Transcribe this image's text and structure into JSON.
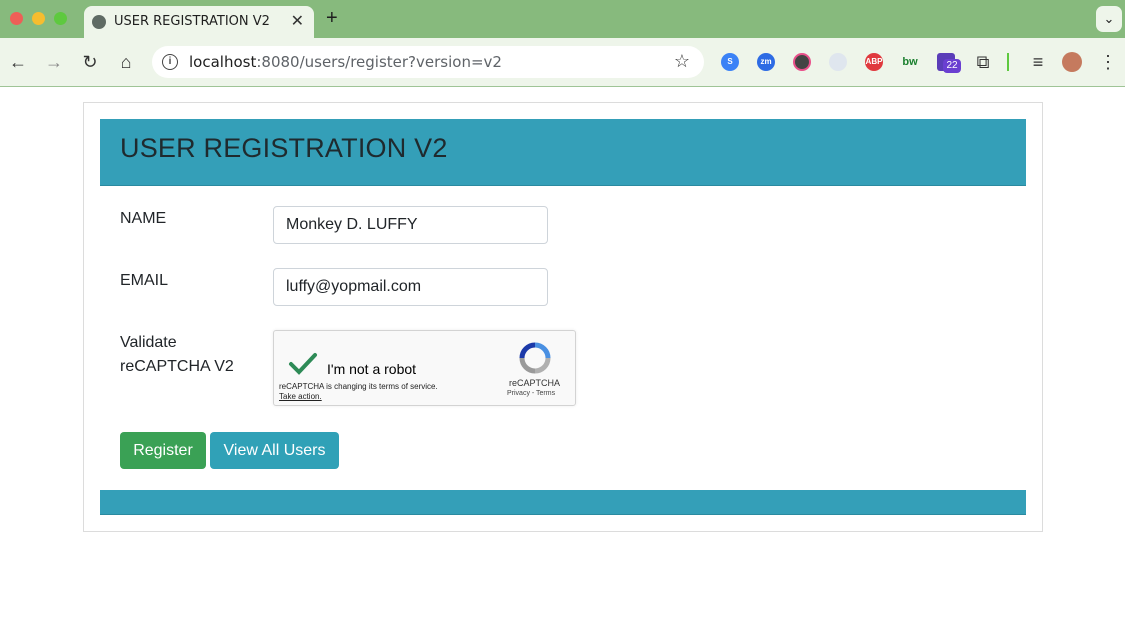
{
  "browser": {
    "tab_title": "USER REGISTRATION V2",
    "tab_close": "✕",
    "new_tab": "+",
    "menu_chevron": "⌄",
    "url_host": "localhost",
    "url_rest": ":8080/users/register?version=v2",
    "extensions": [
      {
        "name": "zm",
        "color": "#2d6be4"
      },
      {
        "name": "ABP",
        "color": "#e0393e"
      },
      {
        "name": "bw",
        "color": "#1a7f2e"
      }
    ],
    "badge_count": "22"
  },
  "page": {
    "title": "USER REGISTRATION V2",
    "name_label": "NAME",
    "name_value": "Monkey D. LUFFY",
    "email_label": "EMAIL",
    "email_value": "luffy@yopmail.com",
    "captcha_label_line1": "Validate",
    "captcha_label_line2": "reCAPTCHA V2",
    "captcha": {
      "checkbox_label": "I'm not a robot",
      "note": "reCAPTCHA is changing its terms of service.",
      "note_link": "Take action.",
      "brand": "reCAPTCHA",
      "terms": "Privacy - Terms"
    },
    "register_button": "Register",
    "view_users_button": "View All Users"
  },
  "colors": {
    "header": "#349fb8",
    "register": "#3aa155",
    "view_users": "#30a1b7"
  }
}
